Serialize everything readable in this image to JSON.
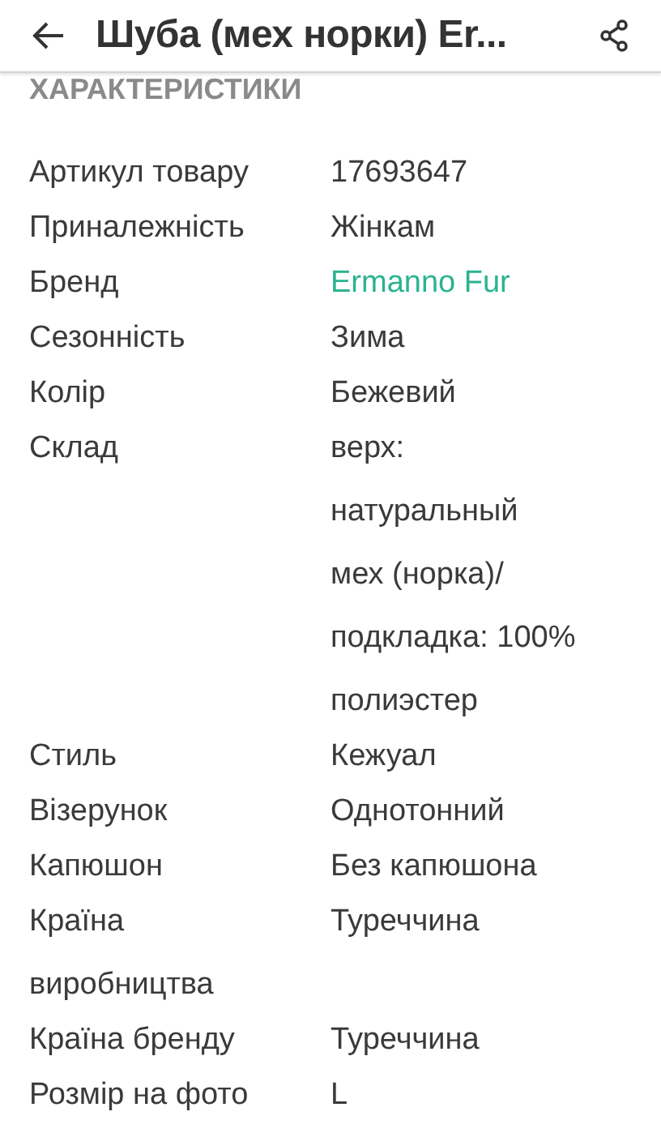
{
  "header": {
    "title": "Шуба (мех норки) Er..."
  },
  "section": {
    "title": "ХАРАКТЕРИСТИКИ"
  },
  "specs": [
    {
      "label": "Артикул товару",
      "value": "17693647",
      "kind": "text"
    },
    {
      "label": "Приналежність",
      "value": "Жінкам",
      "kind": "text"
    },
    {
      "label": "Бренд",
      "value": "Ermanno Fur",
      "kind": "link"
    },
    {
      "label": "Сезонність",
      "value": "Зима",
      "kind": "text"
    },
    {
      "label": "Колір",
      "value": "Бежевий",
      "kind": "text"
    },
    {
      "label": "Склад",
      "value": "верх:\nнатуральный\nмех (норка)/\nподкладка: 100%\nполиэстер",
      "kind": "text"
    },
    {
      "label": "Стиль",
      "value": "Кежуал",
      "kind": "text"
    },
    {
      "label": "Візерунок",
      "value": "Однотонний",
      "kind": "text"
    },
    {
      "label": "Капюшон",
      "value": "Без капюшона",
      "kind": "text"
    },
    {
      "label": "Країна\nвиробництва",
      "value": "Туреччина",
      "kind": "text"
    },
    {
      "label": "Країна бренду",
      "value": "Туреччина",
      "kind": "text"
    },
    {
      "label": "Розмір на фото",
      "value": "L",
      "kind": "text"
    }
  ]
}
